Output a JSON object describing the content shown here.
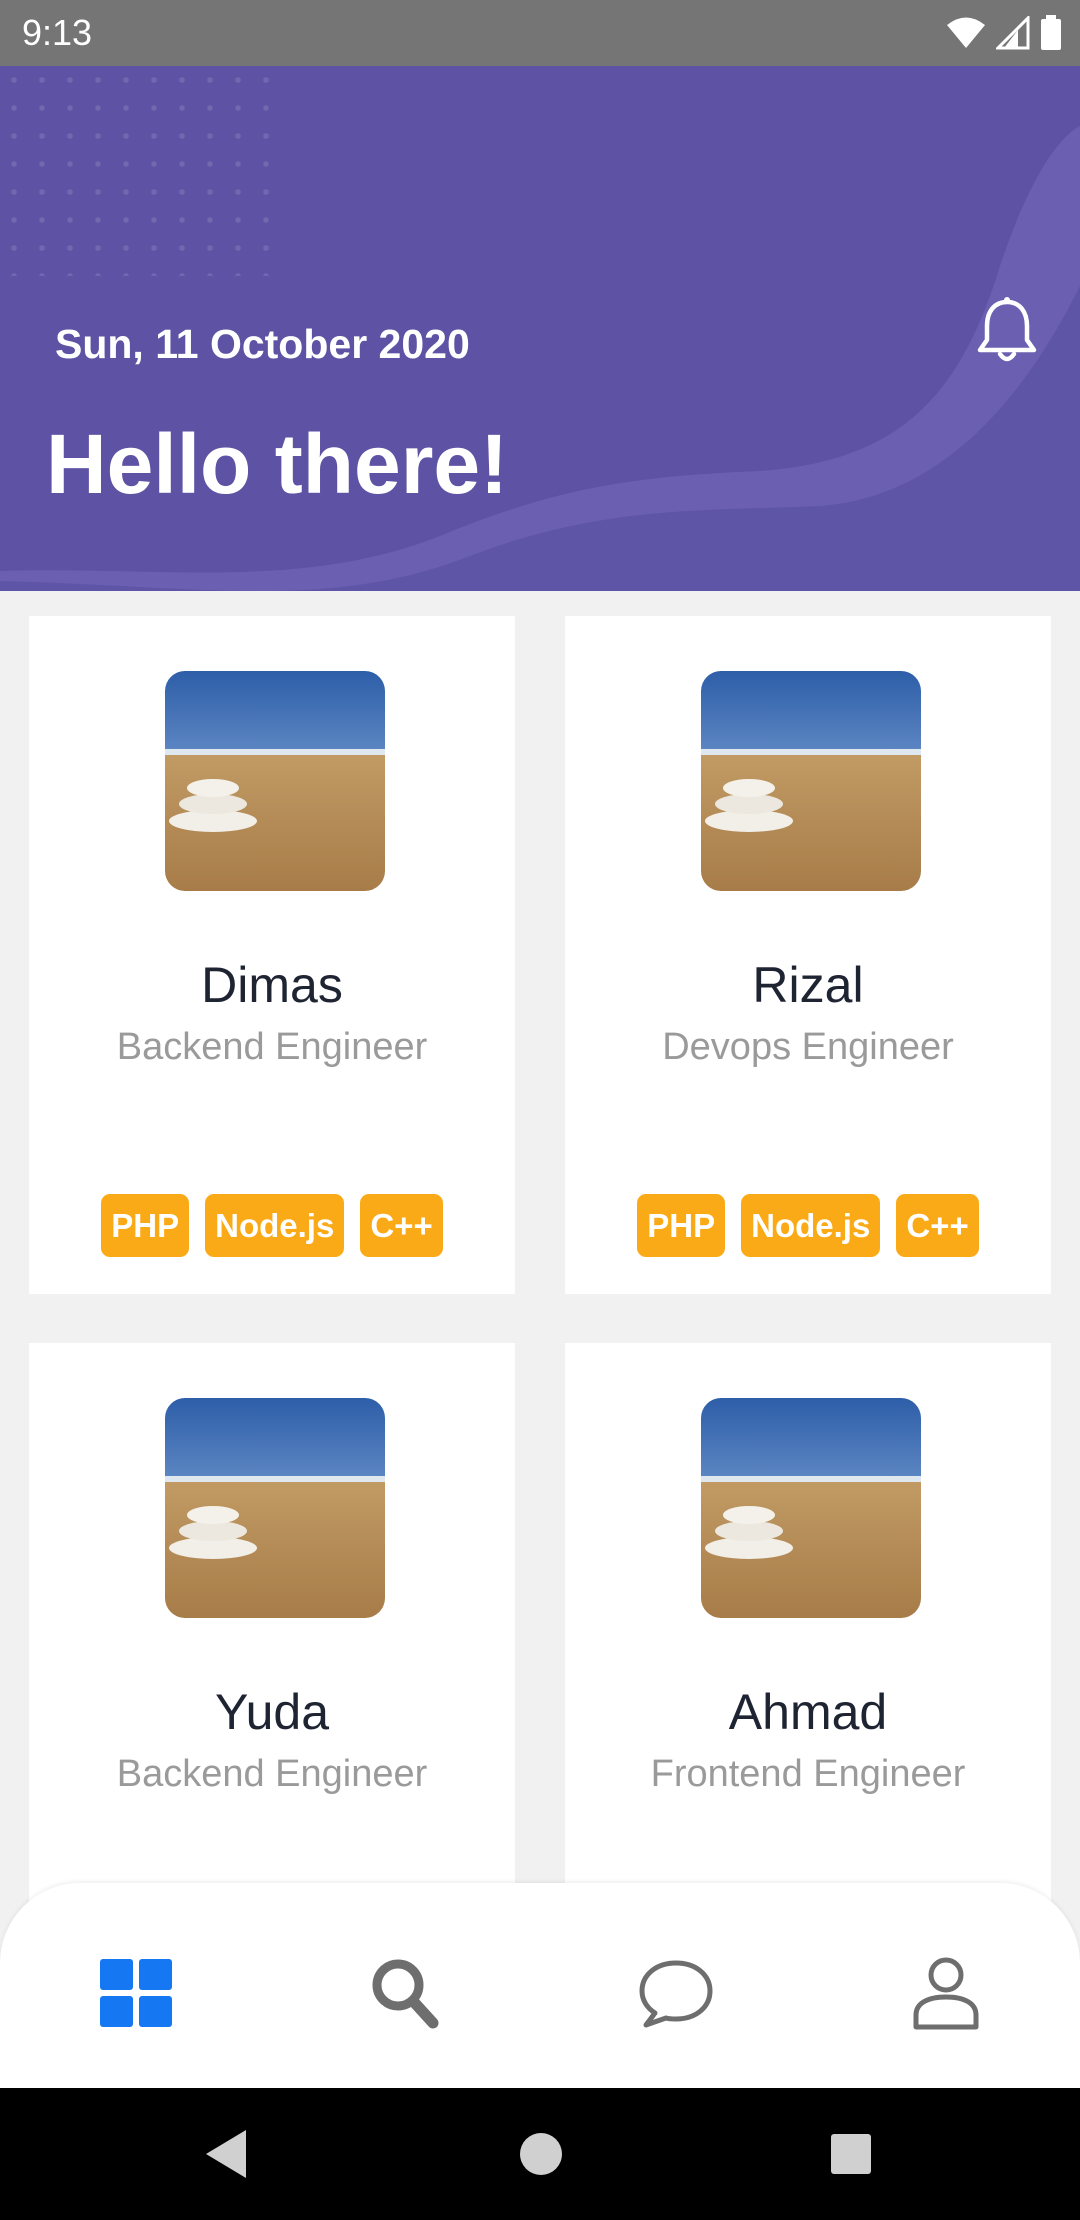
{
  "status_bar": {
    "time": "9:13"
  },
  "header": {
    "date": "Sun, 11 October 2020",
    "greeting": "Hello there!"
  },
  "people": [
    {
      "name": "Dimas",
      "role": "Backend Engineer",
      "tags": [
        "PHP",
        "Node.js",
        "C++"
      ]
    },
    {
      "name": "Rizal",
      "role": "Devops Engineer",
      "tags": [
        "PHP",
        "Node.js",
        "C++"
      ]
    },
    {
      "name": "Yuda",
      "role": "Backend Engineer",
      "tags": []
    },
    {
      "name": "Ahmad",
      "role": "Frontend Engineer",
      "tags": []
    }
  ],
  "bottom_nav": {
    "items": [
      {
        "icon": "grid-icon",
        "active": true
      },
      {
        "icon": "search-icon",
        "active": false
      },
      {
        "icon": "chat-icon",
        "active": false
      },
      {
        "icon": "profile-icon",
        "active": false
      }
    ]
  },
  "colors": {
    "header_bg": "#5d52a3",
    "tag_bg": "#fbaa17",
    "nav_active": "#1677f2",
    "nav_inactive": "#6e6e6e"
  }
}
